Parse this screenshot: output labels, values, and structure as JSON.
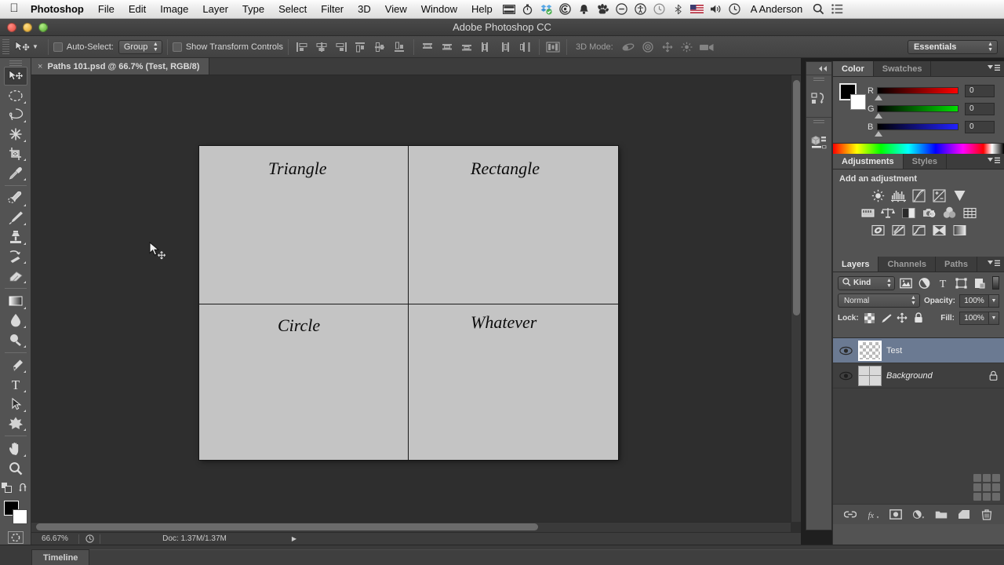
{
  "mac_menu": {
    "apple": "",
    "items": [
      {
        "label": "Photoshop",
        "bold": true
      },
      {
        "label": "File",
        "bold": false
      },
      {
        "label": "Edit",
        "bold": false
      },
      {
        "label": "Image",
        "bold": false
      },
      {
        "label": "Layer",
        "bold": false
      },
      {
        "label": "Type",
        "bold": false
      },
      {
        "label": "Select",
        "bold": false
      },
      {
        "label": "Filter",
        "bold": false
      },
      {
        "label": "3D",
        "bold": false
      },
      {
        "label": "View",
        "bold": false
      },
      {
        "label": "Window",
        "bold": false
      },
      {
        "label": "Help",
        "bold": false
      }
    ],
    "status_icons": [
      "screen-capture-icon",
      "timer-icon",
      "dropbox-icon",
      "creative-cloud-icon",
      "bell-icon",
      "paw-icon",
      "minus-circle-icon",
      "accessibility-icon",
      "history-icon",
      "bluetooth-icon",
      "flag-us-icon",
      "volume-icon",
      "clock-icon"
    ],
    "user": "A Anderson",
    "search_icon": "search-icon",
    "list_icon": "notification-center-icon"
  },
  "window": {
    "title": "Adobe Photoshop CC"
  },
  "options_bar": {
    "tool_icon": "move-tool-icon",
    "tool_preset_arrow": "chevron-down-icon",
    "auto_select_label": "Auto-Select:",
    "auto_select_value": "Group",
    "show_transform_label": "Show Transform Controls",
    "align_icons": [
      "align-left-edges-icon",
      "align-horizontal-centers-icon",
      "align-right-edges-icon",
      "align-top-edges-icon",
      "align-vertical-centers-icon",
      "align-bottom-edges-icon"
    ],
    "distribute_icons": [
      "distribute-top-edges-icon",
      "distribute-vertical-centers-icon",
      "distribute-bottom-edges-icon",
      "distribute-left-edges-icon",
      "distribute-horizontal-centers-icon",
      "distribute-right-edges-icon"
    ],
    "auto_align_icon": "auto-align-layers-icon",
    "mode3d_label": "3D Mode:",
    "mode3d_icons": [
      "orbit-3d-icon",
      "roll-3d-icon",
      "pan-3d-icon",
      "slide-3d-icon",
      "scale-3d-icon"
    ],
    "workspace": "Essentials"
  },
  "toolbar": {
    "tools": [
      {
        "name": "move-tool",
        "active": true,
        "flyout": false
      },
      {
        "name": "elliptical-marquee-tool",
        "active": false,
        "flyout": true
      },
      {
        "name": "lasso-tool",
        "active": false,
        "flyout": true
      },
      {
        "name": "magic-wand-tool",
        "active": false,
        "flyout": true
      },
      {
        "name": "crop-tool",
        "active": false,
        "flyout": true
      },
      {
        "name": "eyedropper-tool",
        "active": false,
        "flyout": true
      },
      {
        "name": "spot-healing-brush-tool",
        "active": false,
        "flyout": true
      },
      {
        "name": "brush-tool",
        "active": false,
        "flyout": true
      },
      {
        "name": "clone-stamp-tool",
        "active": false,
        "flyout": true
      },
      {
        "name": "history-brush-tool",
        "active": false,
        "flyout": true
      },
      {
        "name": "eraser-tool",
        "active": false,
        "flyout": true
      },
      {
        "name": "gradient-tool",
        "active": false,
        "flyout": true
      },
      {
        "name": "blur-tool",
        "active": false,
        "flyout": true
      },
      {
        "name": "dodge-tool",
        "active": false,
        "flyout": true
      },
      {
        "name": "pen-tool",
        "active": false,
        "flyout": true
      },
      {
        "name": "type-tool",
        "active": false,
        "flyout": true
      },
      {
        "name": "path-selection-tool",
        "active": false,
        "flyout": true
      },
      {
        "name": "custom-shape-tool",
        "active": false,
        "flyout": true
      },
      {
        "name": "hand-tool",
        "active": false,
        "flyout": true
      },
      {
        "name": "zoom-tool",
        "active": false,
        "flyout": false
      }
    ],
    "foreground_color": "#000000",
    "background_color": "#ffffff",
    "default_colors_icon": "default-colors-icon",
    "swap_colors_icon": "swap-colors-icon",
    "quick_mask_icon": "quick-mask-icon"
  },
  "document": {
    "tab_title": "Paths 101.psd @ 66.7% (Test, RGB/8)",
    "close_glyph": "×"
  },
  "canvas": {
    "background": "#c4c4c4",
    "cells": [
      {
        "label": "Triangle",
        "pos": "top-left"
      },
      {
        "label": "Rectangle",
        "pos": "top-right"
      },
      {
        "label": "Circle",
        "pos": "bottom-left"
      },
      {
        "label": "Whatever",
        "pos": "bottom-right"
      }
    ],
    "cursor_icon": "move-cursor"
  },
  "status_bar": {
    "zoom": "66.67%",
    "clock_icon": "timing-icon",
    "doc_info": "Doc: 1.37M/1.37M",
    "arrow_glyph": "▶"
  },
  "timeline": {
    "tab_label": "Timeline"
  },
  "icon_dock": {
    "collapse_icon": "collapse-panels-icon",
    "items": [
      {
        "name": "history-panel-icon"
      },
      {
        "name": "3d-panel-icon"
      }
    ]
  },
  "color_panel": {
    "tabs": [
      {
        "label": "Color",
        "active": true
      },
      {
        "label": "Swatches",
        "active": false
      }
    ],
    "menu_icon": "panel-menu-icon",
    "foreground": "#000000",
    "background": "#ffffff",
    "channels": [
      {
        "name": "R",
        "value": "0"
      },
      {
        "name": "G",
        "value": "0"
      },
      {
        "name": "B",
        "value": "0"
      }
    ]
  },
  "adjustments_panel": {
    "tabs": [
      {
        "label": "Adjustments",
        "active": true
      },
      {
        "label": "Styles",
        "active": false
      }
    ],
    "menu_icon": "panel-menu-icon",
    "heading": "Add an adjustment",
    "row1": [
      "brightness-contrast-icon",
      "levels-icon",
      "curves-icon",
      "exposure-icon",
      "vibrance-icon"
    ],
    "row2": [
      "hue-saturation-icon",
      "color-balance-icon",
      "black-white-icon",
      "photo-filter-icon",
      "channel-mixer-icon",
      "color-lookup-icon"
    ],
    "row3": [
      "invert-icon",
      "posterize-icon",
      "threshold-icon",
      "selective-color-icon",
      "gradient-map-icon"
    ]
  },
  "layers_panel": {
    "tabs": [
      {
        "label": "Layers",
        "active": true
      },
      {
        "label": "Channels",
        "active": false
      },
      {
        "label": "Paths",
        "active": false
      }
    ],
    "menu_icon": "panel-menu-icon",
    "filter_label": "Kind",
    "filter_search_icon": "search-icon",
    "filter_icons": [
      "filter-pixel-icon",
      "filter-adjustment-icon",
      "filter-type-icon",
      "filter-shape-icon",
      "filter-smart-object-icon"
    ],
    "blend_mode": "Normal",
    "opacity_label": "Opacity:",
    "opacity_value": "100%",
    "lock_label": "Lock:",
    "lock_icons": [
      "lock-transparent-pixels-icon",
      "lock-image-pixels-icon",
      "lock-position-icon",
      "lock-all-icon"
    ],
    "fill_label": "Fill:",
    "fill_value": "100%",
    "layers": [
      {
        "name": "Test",
        "selected": true,
        "visible": true,
        "locked": false,
        "thumb": "transparent",
        "italic": false
      },
      {
        "name": "Background",
        "selected": false,
        "visible": true,
        "locked": true,
        "thumb": "image",
        "italic": true
      }
    ],
    "footer_icons": [
      "link-layers-icon",
      "layer-style-icon",
      "layer-mask-icon",
      "new-adjustment-layer-icon",
      "new-group-icon",
      "new-layer-icon",
      "delete-layer-icon"
    ]
  }
}
